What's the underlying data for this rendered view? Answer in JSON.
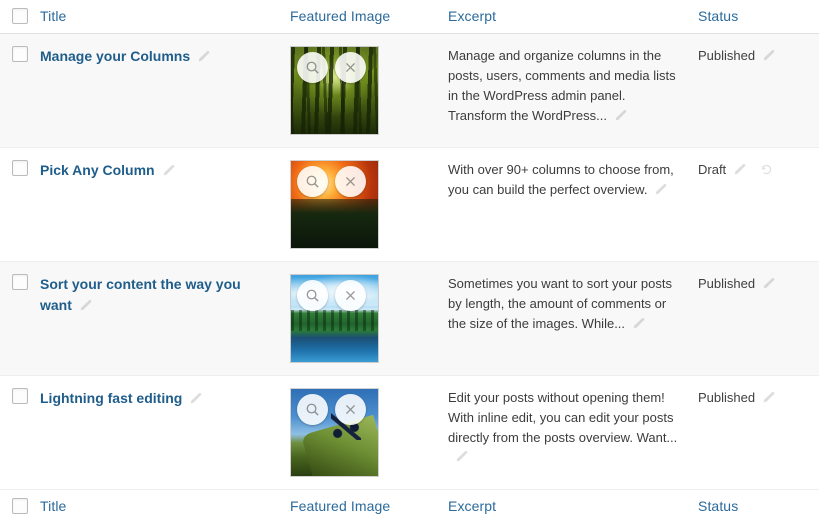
{
  "table": {
    "columns": [
      {
        "key": "cb",
        "label": ""
      },
      {
        "key": "title",
        "label": "Title"
      },
      {
        "key": "image",
        "label": "Featured Image"
      },
      {
        "key": "excerpt",
        "label": "Excerpt"
      },
      {
        "key": "status",
        "label": "Status"
      }
    ],
    "header": {
      "title": "Title",
      "featured_image": "Featured Image",
      "excerpt": "Excerpt",
      "status": "Status"
    },
    "footer": {
      "title": "Title",
      "featured_image": "Featured Image",
      "excerpt": "Excerpt",
      "status": "Status"
    },
    "rows": [
      {
        "title": "Manage your Columns",
        "image_alt": "Sunlit green bamboo forest",
        "image_scene": "forest",
        "excerpt": "Manage and organize columns in the posts, users, comments and media lists in the WordPress admin panel. Transform the WordPress...",
        "status": "Published",
        "has_undo": false,
        "checked": false
      },
      {
        "title": "Pick Any Column",
        "image_alt": "Orange sunset over a river valley",
        "image_scene": "sunset",
        "excerpt": "With over 90+ columns to choose from, you can build the perfect overview.",
        "status": "Draft",
        "has_undo": true,
        "checked": false
      },
      {
        "title": "Sort your content the way you want",
        "image_alt": "Blue lake reflecting green trees",
        "image_scene": "lake",
        "excerpt": "Sometimes you want to sort your posts by length, the amount of comments or the size of the images. While...",
        "status": "Published",
        "has_undo": false,
        "checked": false
      },
      {
        "title": "Lightning fast editing",
        "image_alt": "Mountain biker riding a ridge against blue sky",
        "image_scene": "bike",
        "excerpt": "Edit your posts without opening them! With inline edit, you can edit your posts directly from the posts overview. Want...",
        "status": "Published",
        "has_undo": false,
        "checked": false
      }
    ]
  },
  "icons": {
    "edit_pencil": "pencil-icon",
    "undo": "undo-icon",
    "zoom": "magnifier-icon",
    "remove": "close-icon",
    "select_all_checkbox": "checkbox"
  },
  "colors": {
    "link": "#2b6a9b",
    "title_link": "#1f5d8b",
    "text": "#3c3c3c",
    "row_alt_bg": "#f8f8f8",
    "row_bg": "#ffffff",
    "border": "#eceeef"
  }
}
